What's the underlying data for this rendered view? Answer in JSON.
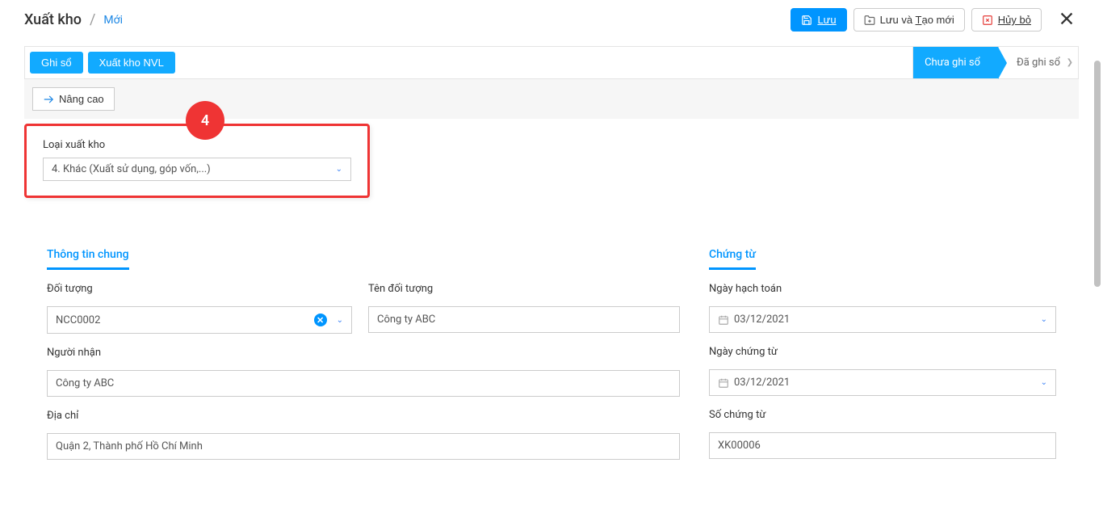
{
  "header": {
    "title": "Xuất kho",
    "subtitle": "Mới",
    "save_label": "Lưu",
    "save_new_label": "Lưu và Tạo mới",
    "cancel_label": "Hủy bỏ"
  },
  "toolbar": {
    "ghi_so_label": "Ghi sổ",
    "xuat_kho_nvl_label": "Xuất kho NVL",
    "status_chua_ghi_so": "Chưa ghi sổ",
    "status_da_ghi_so": "Đã ghi sổ",
    "nang_cao_label": "Nâng cao"
  },
  "badge": {
    "number": "4"
  },
  "loai_xuat_kho": {
    "label": "Loại xuất kho",
    "value": "4. Khác (Xuất sử dụng, góp vốn,...)"
  },
  "sections": {
    "thong_tin_chung": "Thông tin chung",
    "chung_tu": "Chứng từ"
  },
  "fields": {
    "doi_tuong": {
      "label": "Đối tượng",
      "value": "NCC0002"
    },
    "ten_doi_tuong": {
      "label": "Tên đối tượng",
      "value": "Công ty ABC"
    },
    "nguoi_nhan": {
      "label": "Người nhận",
      "value": "Công ty ABC"
    },
    "dia_chi": {
      "label": "Địa chỉ",
      "value": "Quận 2, Thành phố Hồ Chí Minh"
    },
    "ngay_hach_toan": {
      "label": "Ngày hạch toán",
      "value": "03/12/2021"
    },
    "ngay_chung_tu": {
      "label": "Ngày chứng từ",
      "value": "03/12/2021"
    },
    "so_chung_tu": {
      "label": "Số chứng từ",
      "value": "XK00006"
    }
  }
}
